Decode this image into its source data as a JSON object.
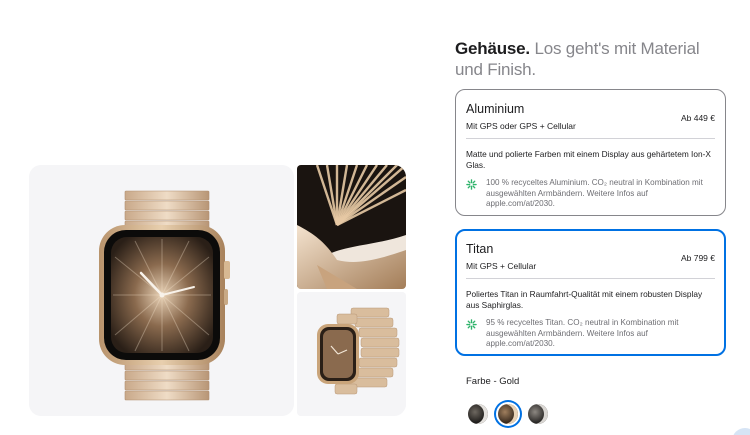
{
  "header": {
    "title_strong": "Gehäuse.",
    "title_muted": "Los geht's mit Material und Finish."
  },
  "options": [
    {
      "title": "Aluminium",
      "subtitle": "Mit GPS oder GPS + Cellular",
      "price": "Ab 449 €",
      "description": "Matte und polierte Farben mit einem Display aus gehärtetem Ion-X Glas.",
      "eco_icon": "leaf-icon",
      "eco_text": "100 % recyceltes Aluminium. CO₂ neutral in Kombination mit ausgewählten Armbändern. Weitere Infos auf apple.com/at/2030.",
      "selected": false
    },
    {
      "title": "Titan",
      "subtitle": "Mit GPS + Cellular",
      "price": "Ab 799 €",
      "description": "Poliertes Titan in Raumfahrt-Qualität mit einem robusten Display aus Saphirglas.",
      "eco_icon": "leaf-icon",
      "eco_text": "95 % recyceltes Titan. CO₂ neutral in Kombination mit ausgewählten Armbändern. Weitere Infos auf apple.com/at/2030.",
      "selected": true
    }
  ],
  "color": {
    "label": "Farbe - Gold",
    "swatches": [
      {
        "name": "Schiefer",
        "color": "#3b3a38",
        "selected": false
      },
      {
        "name": "Gold",
        "color": "#c9a47a",
        "selected": true
      },
      {
        "name": "Natur",
        "color": "#bfbab4",
        "selected": false
      }
    ]
  },
  "colors": {
    "accent": "#0071e3",
    "muted_text": "#86868b",
    "eco_green": "#2fb36b"
  }
}
